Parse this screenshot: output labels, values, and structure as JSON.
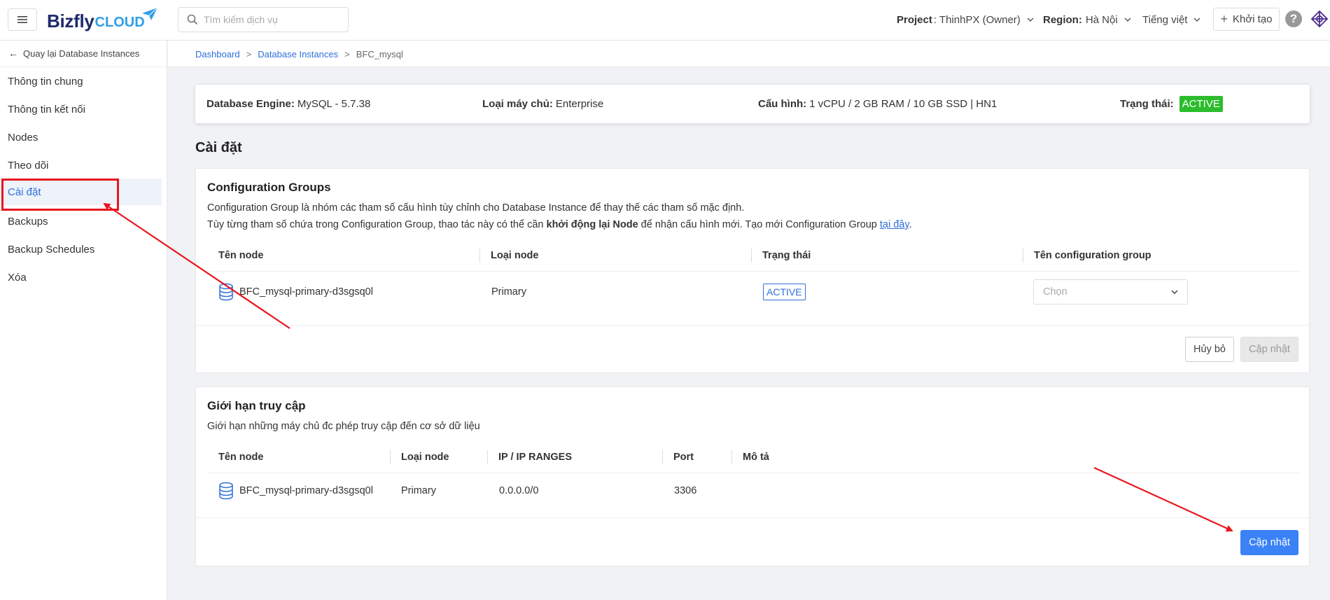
{
  "header": {
    "logo_main": "Bizfly",
    "logo_sub": "CLOUD",
    "search_placeholder": "Tìm kiếm dịch vụ",
    "project_label": "Project",
    "project_value": ": ThinhPX (Owner)",
    "region_label": "Region:",
    "region_value": "Hà Nội",
    "language": "Tiếng việt",
    "create_button": "Khởi tạo",
    "help": "?"
  },
  "sidebar": {
    "back_label": "Quay lại Database Instances",
    "items": [
      {
        "label": "Thông tin chung",
        "active": false
      },
      {
        "label": "Thông tin kết nối",
        "active": false
      },
      {
        "label": "Nodes",
        "active": false
      },
      {
        "label": "Theo dõi",
        "active": false
      },
      {
        "label": "Cài đặt",
        "active": true
      },
      {
        "label": "Backups",
        "active": false
      },
      {
        "label": "Backup Schedules",
        "active": false
      },
      {
        "label": "Xóa",
        "active": false
      }
    ]
  },
  "breadcrumb": {
    "items": [
      "Dashboard",
      "Database Instances",
      "BFC_mysql"
    ],
    "separator": ">"
  },
  "info_bar": {
    "engine_label": "Database Engine:",
    "engine_value": "MySQL - 5.7.38",
    "server_label": "Loại máy chủ:",
    "server_value": "Enterprise",
    "config_label": "Cấu hình:",
    "config_value": "1 vCPU / 2 GB RAM / 10 GB SSD | HN1",
    "status_label": "Trạng thái:",
    "status_value": "ACTIVE"
  },
  "page_title": "Cài đặt",
  "config_groups": {
    "title": "Configuration Groups",
    "desc_line1": "Configuration Group là nhóm các tham số cấu hình tùy chỉnh cho Database Instance để thay thế các tham số mặc định.",
    "desc_line2_a": "Tùy từng tham số chứa trong Configuration Group, thao tác này có thể cần ",
    "desc_line2_bold": "khởi động lại Node",
    "desc_line2_b": " để nhận cấu hình mới. Tạo mới Configuration Group ",
    "desc_link": "tại đây",
    "desc_end": ".",
    "columns": [
      "Tên node",
      "Loại node",
      "Trạng thái",
      "Tên configuration group"
    ],
    "row": {
      "node_name": "BFC_mysql-primary-d3sgsq0l",
      "node_type": "Primary",
      "status": "ACTIVE",
      "select_placeholder": "Chọn"
    },
    "cancel_button": "Hủy bỏ",
    "update_button": "Cập nhật"
  },
  "access_limit": {
    "title": "Giới hạn truy cập",
    "desc": "Giới hạn những máy chủ đc phép truy cập đến cơ sở dữ liệu",
    "columns": [
      "Tên node",
      "Loại node",
      "IP / IP RANGES",
      "Port",
      "Mô tả"
    ],
    "row": {
      "node_name": "BFC_mysql-primary-d3sgsq0l",
      "node_type": "Primary",
      "ip": "0.0.0.0/0",
      "port": "3306",
      "desc": ""
    },
    "update_button": "Cập nhật"
  },
  "colors": {
    "primary": "#3b82f6",
    "active_green": "#2bbc2b",
    "annotation_red": "#e8161e",
    "logo_navy": "#1d2a6b",
    "logo_cyan": "#2f9fe8"
  }
}
